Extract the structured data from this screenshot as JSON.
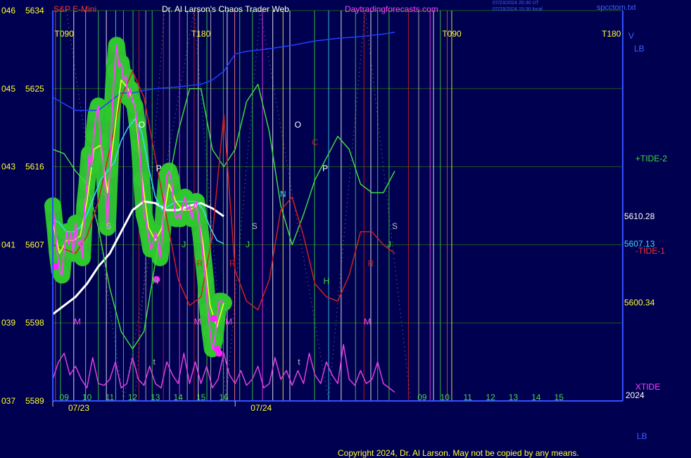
{
  "header": {
    "instrument": "S&P E-Mini",
    "title": "Dr. Al Larson's Chaos Trader Web",
    "site": "Daytradingforecasts.com",
    "timestamp_ut": "07/23/2024 20:30 UT",
    "timestamp_local": "07/23/2024 15:30 local",
    "file": "spcctom.txt"
  },
  "footer": {
    "copyright": "Copyright 2024, Dr. Al Larson. May not be copied by any means.",
    "lb_label": "LB"
  },
  "colors": {
    "background": "#000050",
    "grid": "#1c5a1c",
    "price": "#ff40ff",
    "price_band": "#2fc82f",
    "ma_fast": "#ffff30",
    "ma_mid": "#40d8ff",
    "ma_slow": "#ffffff",
    "tide_plus": "#40d840",
    "tide_minus": "#d02020",
    "xtide": "#e040e0",
    "blue_line": "#2040ff"
  },
  "chart_data": {
    "type": "line",
    "title": "S&P E-Mini",
    "xlabel": "",
    "ylabel": "",
    "ylim": [
      5589,
      5634
    ],
    "y_ticks": [
      {
        "left": "046",
        "value": 5634
      },
      {
        "left": "045",
        "value": 5625
      },
      {
        "left": "043",
        "value": 5616
      },
      {
        "left": "041",
        "value": 5607
      },
      {
        "left": "039",
        "value": 5598
      },
      {
        "left": "037",
        "value": 5589
      }
    ],
    "x_hour_ticks": [
      {
        "label": "09",
        "x": 9.0
      },
      {
        "label": "10",
        "x": 10.0
      },
      {
        "label": "11",
        "x": 11.0
      },
      {
        "label": "12",
        "x": 12.0
      },
      {
        "label": "13",
        "x": 13.0
      },
      {
        "label": "14",
        "x": 14.0
      },
      {
        "label": "15",
        "x": 15.0
      },
      {
        "label": "16",
        "x": 16.0
      },
      {
        "label": "09",
        "x": 24.7
      },
      {
        "label": "10",
        "x": 25.7
      },
      {
        "label": "11",
        "x": 26.7
      },
      {
        "label": "12",
        "x": 27.7
      },
      {
        "label": "13",
        "x": 28.7
      },
      {
        "label": "14",
        "x": 29.7
      },
      {
        "label": "15",
        "x": 30.7
      }
    ],
    "x_date_ticks": [
      {
        "label": "07/23",
        "x": 8.5
      },
      {
        "label": "07/24",
        "x": 16.5
      }
    ],
    "year_label": "2024",
    "right_labels": [
      {
        "text": "5610.28",
        "y": 5610.28,
        "color": "#ffffff"
      },
      {
        "text": "5607.13",
        "y": 5607.13,
        "color": "#40d8ff"
      },
      {
        "text": "5600.34",
        "y": 5600.34,
        "color": "#ffff30"
      }
    ],
    "curve_labels": [
      {
        "text": "+TIDE-2",
        "color": "#40d840"
      },
      {
        "text": "-TIDE-1",
        "color": "#ff3030"
      },
      {
        "text": "XTIDE",
        "color": "#ff40ff"
      }
    ],
    "corner_labels": [
      {
        "text": "V",
        "color": "#4060ff"
      },
      {
        "text": "LB",
        "color": "#4060ff"
      }
    ],
    "tide_labels": [
      {
        "text": "T090",
        "x": 9.0,
        "y": 5631
      },
      {
        "text": "T180",
        "x": 15.0,
        "y": 5631
      },
      {
        "text": "T090",
        "x": 26.0,
        "y": 5631
      },
      {
        "text": "T180",
        "x": 33.0,
        "y": 5631
      }
    ],
    "vertical_lines": [
      {
        "x": 8.62,
        "color": "#c06020"
      },
      {
        "x": 8.84,
        "color": "#40d840"
      },
      {
        "x": 9.42,
        "color": "#ffffff"
      },
      {
        "x": 9.94,
        "color": "#c0c0c0"
      },
      {
        "x": 10.5,
        "color": "#40d840"
      },
      {
        "x": 10.85,
        "color": "#ffffff"
      },
      {
        "x": 11.26,
        "color": "#40d8ff"
      },
      {
        "x": 11.6,
        "color": "#40d840"
      },
      {
        "x": 12.02,
        "color": "#40d840"
      },
      {
        "x": 12.28,
        "color": "#d02020"
      },
      {
        "x": 12.58,
        "color": "#c0c0c0"
      },
      {
        "x": 12.86,
        "color": "#40d840"
      },
      {
        "x": 13.35,
        "color": "#d02020"
      },
      {
        "x": 13.62,
        "color": "#c0c0c0"
      },
      {
        "x": 14.06,
        "color": "#ff40ff"
      },
      {
        "x": 14.4,
        "color": "#c0c0c0"
      },
      {
        "x": 14.7,
        "color": "#d02020"
      },
      {
        "x": 14.88,
        "color": "#ffffff"
      },
      {
        "x": 15.26,
        "color": "#40d840"
      },
      {
        "x": 15.43,
        "color": "#c0c0c0"
      },
      {
        "x": 15.98,
        "color": "#40d840"
      },
      {
        "x": 16.15,
        "color": "#ffffff"
      },
      {
        "x": 16.48,
        "color": "#ff8080"
      },
      {
        "x": 16.7,
        "color": "#40d840"
      },
      {
        "x": 17.26,
        "color": "#40d840"
      },
      {
        "x": 17.7,
        "color": "#ff40ff"
      },
      {
        "x": 18.15,
        "color": "#ffffff"
      },
      {
        "x": 18.6,
        "color": "#ffff30"
      },
      {
        "x": 18.9,
        "color": "#ffffff"
      },
      {
        "x": 19.98,
        "color": "#40d840"
      },
      {
        "x": 20.6,
        "color": "#40d8ff"
      },
      {
        "x": 21.15,
        "color": "#ffffff"
      },
      {
        "x": 21.78,
        "color": "#40d840"
      },
      {
        "x": 22.15,
        "color": "#d02020"
      },
      {
        "x": 22.45,
        "color": "#ffffff"
      },
      {
        "x": 22.75,
        "color": "#40d840"
      },
      {
        "x": 23.25,
        "color": "#40d840"
      },
      {
        "x": 24.1,
        "color": "#d02020"
      },
      {
        "x": 24.55,
        "color": "#c0c0c0"
      },
      {
        "x": 25.05,
        "color": "#ff40ff"
      },
      {
        "x": 25.2,
        "color": "#ffffff"
      },
      {
        "x": 25.5,
        "color": "#40d840"
      },
      {
        "x": 25.8,
        "color": "#c06020"
      },
      {
        "x": 26.0,
        "color": "#ffff30"
      }
    ],
    "markers": [
      {
        "text": "S",
        "x": 10.95,
        "y": 5608.8,
        "color": "#c0c0c0"
      },
      {
        "text": "O",
        "x": 12.4,
        "y": 5620.5,
        "color": "#ffffff"
      },
      {
        "text": "P",
        "x": 13.15,
        "y": 5615.5,
        "color": "#ffffff"
      },
      {
        "text": "H",
        "x": 13.0,
        "y": 5602.5,
        "color": "#40d840"
      },
      {
        "text": "J",
        "x": 14.25,
        "y": 5606.7,
        "color": "#40d840"
      },
      {
        "text": "R",
        "x": 14.95,
        "y": 5604.5,
        "color": "#d02020"
      },
      {
        "text": "M",
        "x": 9.58,
        "y": 5597.8,
        "color": "#ff40ff"
      },
      {
        "text": "M",
        "x": 14.85,
        "y": 5597.8,
        "color": "#ff40ff"
      },
      {
        "text": "M",
        "x": 16.22,
        "y": 5597.8,
        "color": "#ff40ff"
      },
      {
        "text": "R",
        "x": 16.38,
        "y": 5604.5,
        "color": "#d02020"
      },
      {
        "text": "S",
        "x": 17.35,
        "y": 5608.8,
        "color": "#c0c0c0"
      },
      {
        "text": "J",
        "x": 17.05,
        "y": 5606.7,
        "color": "#40d840"
      },
      {
        "text": "N",
        "x": 18.6,
        "y": 5612.5,
        "color": "#40d8ff"
      },
      {
        "text": "O",
        "x": 19.25,
        "y": 5620.5,
        "color": "#ffffff"
      },
      {
        "text": "C",
        "x": 20.0,
        "y": 5618.5,
        "color": "#d02020"
      },
      {
        "text": "P",
        "x": 20.45,
        "y": 5615.5,
        "color": "#ffffff"
      },
      {
        "text": "H",
        "x": 20.5,
        "y": 5602.5,
        "color": "#40d840"
      },
      {
        "text": "M",
        "x": 22.3,
        "y": 5597.8,
        "color": "#ff40ff"
      },
      {
        "text": "R",
        "x": 22.45,
        "y": 5604.5,
        "color": "#d02020"
      },
      {
        "text": "S",
        "x": 23.5,
        "y": 5608.8,
        "color": "#c0c0c0"
      },
      {
        "text": "J",
        "x": 23.25,
        "y": 5606.7,
        "color": "#40d840"
      },
      {
        "text": "t",
        "x": 12.95,
        "y": 5593.2,
        "color": "#c0c0c0"
      },
      {
        "text": "t",
        "x": 19.3,
        "y": 5593.2,
        "color": "#c0c0c0"
      }
    ],
    "series": [
      {
        "name": "price",
        "color": "#ff40ff",
        "x": [
          8.5,
          8.6,
          8.7,
          8.8,
          8.9,
          9.0,
          9.1,
          9.2,
          9.3,
          9.4,
          9.5,
          9.6,
          9.7,
          9.8,
          9.9,
          10.0,
          10.1,
          10.2,
          10.3,
          10.4,
          10.5,
          10.6,
          10.7,
          10.8,
          10.9,
          11.0,
          11.1,
          11.2,
          11.3,
          11.4,
          11.5,
          11.6,
          11.7,
          11.8,
          11.9,
          12.0,
          12.1,
          12.2,
          12.3,
          12.4,
          12.5,
          12.6,
          12.7,
          12.8,
          12.9,
          13.0,
          13.1,
          13.2,
          13.3,
          13.4,
          13.5,
          13.6,
          13.7,
          13.8,
          13.9,
          14.0,
          14.1,
          14.2,
          14.3,
          14.4,
          14.5,
          14.6,
          14.7,
          14.8,
          14.9,
          15.0,
          15.1,
          15.2,
          15.3,
          15.4,
          15.5,
          15.6,
          15.7,
          15.8,
          15.9,
          16.0
        ],
        "y": [
          5611.5,
          5609.0,
          5606.0,
          5604.0,
          5603.5,
          5606.5,
          5608.5,
          5607.0,
          5608.5,
          5606.0,
          5609.5,
          5607.0,
          5607.5,
          5605.5,
          5611.5,
          5614.0,
          5617.5,
          5616.0,
          5619.5,
          5622.0,
          5623.0,
          5619.0,
          5617.0,
          5613.5,
          5609.0,
          5615.5,
          5622.0,
          5627.0,
          5630.0,
          5627.5,
          5628.0,
          5626.0,
          5626.5,
          5624.0,
          5625.0,
          5623.5,
          5623.0,
          5621.0,
          5618.5,
          5614.5,
          5610.5,
          5609.5,
          5608.0,
          5606.5,
          5607.0,
          5608.5,
          5607.5,
          5605.5,
          5608.0,
          5612.0,
          5615.0,
          5615.5,
          5614.5,
          5612.0,
          5610.0,
          5610.5,
          5610.0,
          5611.5,
          5612.5,
          5611.0,
          5611.5,
          5610.0,
          5611.5,
          5612.0,
          5610.0,
          5608.0,
          5605.5,
          5603.0,
          5599.5,
          5597.0,
          5595.0,
          5596.0,
          5598.5,
          5600.5,
          5600.5,
          5600.3
        ]
      },
      {
        "name": "MA fast",
        "color": "#ffff30",
        "x": [
          8.5,
          8.8,
          9.1,
          9.4,
          9.7,
          10.0,
          10.3,
          10.6,
          10.9,
          11.2,
          11.5,
          11.8,
          12.1,
          12.4,
          12.7,
          13.0,
          13.3,
          13.6,
          13.9,
          14.2,
          14.5,
          14.8,
          15.1,
          15.4,
          15.7,
          16.0
        ],
        "y": [
          5609.5,
          5606.0,
          5607.5,
          5607.5,
          5608.0,
          5612.0,
          5618.0,
          5618.5,
          5613.0,
          5620.0,
          5626.0,
          5625.0,
          5623.0,
          5615.0,
          5609.0,
          5607.5,
          5609.0,
          5614.0,
          5612.0,
          5611.0,
          5611.0,
          5611.5,
          5607.0,
          5600.0,
          5597.5,
          5600.3
        ]
      },
      {
        "name": "MA mid",
        "color": "#40d8ff",
        "x": [
          8.5,
          8.8,
          9.1,
          9.4,
          9.7,
          10.0,
          10.3,
          10.6,
          10.9,
          11.2,
          11.5,
          11.8,
          12.1,
          12.4,
          12.7,
          13.0,
          13.3,
          13.6,
          13.9,
          14.2,
          14.5,
          14.8,
          15.1,
          15.4,
          15.7,
          16.0
        ],
        "y": [
          5610.0,
          5609.5,
          5608.5,
          5608.5,
          5609.0,
          5610.5,
          5612.5,
          5614.5,
          5615.5,
          5616.5,
          5619.0,
          5620.5,
          5621.5,
          5620.0,
          5616.0,
          5612.5,
          5611.0,
          5611.5,
          5612.0,
          5612.0,
          5612.0,
          5612.0,
          5611.0,
          5609.0,
          5607.5,
          5607.13
        ]
      },
      {
        "name": "MA slow",
        "color": "#ffffff",
        "x": [
          8.5,
          9.0,
          9.5,
          10.0,
          10.5,
          11.0,
          11.5,
          12.0,
          12.5,
          13.0,
          13.5,
          14.0,
          14.5,
          15.0,
          15.5,
          16.0
        ],
        "y": [
          5599.0,
          5600.0,
          5601.0,
          5602.5,
          5604.5,
          5606.0,
          5608.5,
          5611.0,
          5612.0,
          5611.8,
          5611.0,
          5611.0,
          5611.5,
          5611.8,
          5611.2,
          5610.28
        ]
      },
      {
        "name": "+TIDE-2",
        "color": "#40d840",
        "x": [
          8.5,
          9.0,
          9.5,
          10.0,
          10.5,
          11.0,
          11.5,
          12.0,
          12.5,
          13.0,
          13.5,
          14.0,
          14.5,
          15.0,
          15.5,
          16.0,
          16.5,
          17.0,
          17.5,
          18.0,
          18.5,
          19.0,
          19.5,
          20.0,
          20.5,
          21.0,
          21.5,
          22.0,
          22.5,
          23.0,
          23.5
        ],
        "y": [
          5618.0,
          5617.5,
          5615.5,
          5614.0,
          5609.0,
          5602.0,
          5597.0,
          5595.0,
          5597.0,
          5605.0,
          5613.0,
          5620.0,
          5625.0,
          5625.0,
          5618.0,
          5616.0,
          5618.0,
          5623.5,
          5625.5,
          5620.0,
          5611.5,
          5607.0,
          5610.5,
          5614.5,
          5617.0,
          5619.5,
          5618.0,
          5614.0,
          5613.0,
          5613.0,
          5615.5
        ]
      },
      {
        "name": "-TIDE-1",
        "color": "#d02020",
        "x": [
          8.5,
          9.0,
          9.5,
          10.0,
          10.5,
          11.0,
          11.5,
          12.0,
          12.5,
          13.0,
          13.5,
          14.0,
          14.5,
          15.0,
          15.5,
          16.0,
          16.5,
          17.0,
          17.5,
          18.0,
          18.5,
          19.0,
          19.5,
          20.0,
          20.5,
          21.0,
          21.5,
          22.0,
          22.5,
          23.0,
          23.5
        ],
        "y": [
          5607.0,
          5606.5,
          5606.0,
          5608.0,
          5612.0,
          5618.0,
          5624.0,
          5627.0,
          5624.0,
          5617.0,
          5610.0,
          5603.0,
          5600.0,
          5601.0,
          5608.0,
          5622.0,
          5604.0,
          5600.5,
          5599.5,
          5603.0,
          5611.0,
          5612.5,
          5608.0,
          5602.5,
          5601.0,
          5600.5,
          5603.5,
          5608.5,
          5608.5,
          5607.0,
          5606.0
        ]
      },
      {
        "name": "XTIDE",
        "color": "#e040e0",
        "x": [
          8.5,
          8.75,
          9.0,
          9.25,
          9.5,
          9.75,
          10.0,
          10.25,
          10.5,
          10.75,
          11.0,
          11.25,
          11.5,
          11.75,
          12.0,
          12.25,
          12.5,
          12.75,
          13.0,
          13.25,
          13.5,
          13.75,
          14.0,
          14.25,
          14.5,
          14.75,
          15.0,
          15.25,
          15.5,
          15.75,
          16.0,
          16.25,
          16.5,
          16.75,
          17.0,
          17.25,
          17.5,
          17.75,
          18.0,
          18.25,
          18.5,
          18.75,
          19.0,
          19.25,
          19.5,
          19.75,
          20.0,
          20.25,
          20.5,
          20.75,
          21.0,
          21.25,
          21.5,
          21.75,
          22.0,
          22.25,
          22.5,
          22.75,
          23.0,
          23.25,
          23.5
        ],
        "y": [
          5591.5,
          5593.5,
          5594.5,
          5592.0,
          5593.0,
          5591.5,
          5590.5,
          5594.0,
          5591.0,
          5590.8,
          5591.5,
          5593.5,
          5590.5,
          5591.0,
          5594.0,
          5591.5,
          5590.8,
          5593.0,
          5591.0,
          5590.5,
          5593.5,
          5592.0,
          5591.0,
          5594.5,
          5591.0,
          5593.5,
          5591.0,
          5593.0,
          5590.5,
          5591.5,
          5594.5,
          5592.0,
          5591.0,
          5592.5,
          5590.8,
          5591.5,
          5593.0,
          5590.5,
          5591.0,
          5594.0,
          5591.5,
          5592.5,
          5590.8,
          5592.5,
          5591.0,
          5594.5,
          5592.0,
          5591.0,
          5593.5,
          5592.0,
          5591.0,
          5595.5,
          5591.5,
          5590.8,
          5592.5,
          5591.0,
          5591.5,
          5593.5,
          5591.0,
          5590.5,
          5590.0
        ]
      },
      {
        "name": "",
        "color": "#2040ff",
        "x": [
          8.5,
          9.5,
          10.5,
          11.0,
          11.5,
          12.0,
          12.5,
          13.0,
          14.0,
          15.0,
          15.5,
          16.0,
          16.5,
          17.0,
          18.0,
          19.0,
          20.0,
          21.0,
          22.0,
          23.0,
          23.5
        ],
        "y": [
          5624.0,
          5622.5,
          5622.5,
          5623.5,
          5624.5,
          5624.5,
          5624.8,
          5625.0,
          5625.2,
          5625.5,
          5626.0,
          5627.0,
          5629.0,
          5629.3,
          5629.6,
          5630.0,
          5630.5,
          5630.8,
          5631.0,
          5631.3,
          5631.5
        ]
      }
    ],
    "price_dots": [
      {
        "x": 8.6,
        "y": 5604.5
      },
      {
        "x": 13.05,
        "y": 5603.0
      },
      {
        "x": 15.55,
        "y": 5598.5
      },
      {
        "x": 15.7,
        "y": 5595.0
      },
      {
        "x": 15.8,
        "y": 5594.5
      }
    ]
  }
}
